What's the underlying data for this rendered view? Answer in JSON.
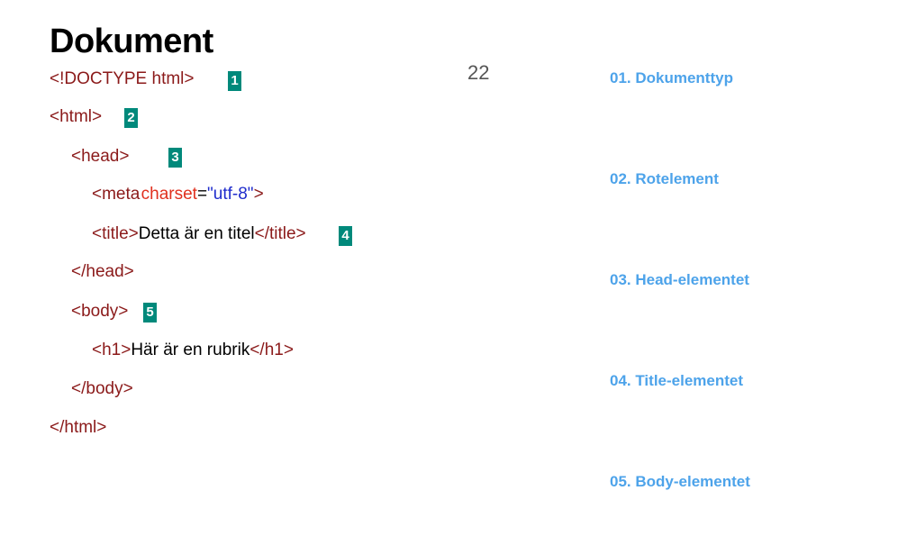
{
  "slide": {
    "title": "Dokument",
    "page_number": "22"
  },
  "code": {
    "line1": {
      "text": "<!DOCTYPE html>"
    },
    "line2": {
      "tag": "<html>"
    },
    "line3": {
      "tag": "<head>"
    },
    "line4": {
      "tag_open": "<meta",
      "attr": "charset",
      "eq": "=",
      "value": "\"utf-8\"",
      "tag_close": ">"
    },
    "line5": {
      "tag_open": "<title>",
      "text": "Detta är en titel",
      "tag_close": "</title>"
    },
    "line6": {
      "tag": "</head>"
    },
    "line7": {
      "tag": "<body>"
    },
    "line8": {
      "tag_open": "<h1>",
      "text": "Här är en rubrik",
      "tag_close": "</h1>"
    },
    "line9": {
      "tag": "</body>"
    },
    "line10": {
      "tag": "</html>"
    }
  },
  "badges": [
    "1",
    "2",
    "3",
    "4",
    "5"
  ],
  "legend": [
    "01. Dokumenttyp",
    "02. Rotelement",
    "03. Head-elementet",
    "04. Title-elementet",
    "05. Body-elementet"
  ],
  "colors": {
    "tag": "#8b1a1a",
    "attribute": "#e0301e",
    "value": "#1f2ccc",
    "badge": "#00897b",
    "legend": "#4da3ea"
  }
}
